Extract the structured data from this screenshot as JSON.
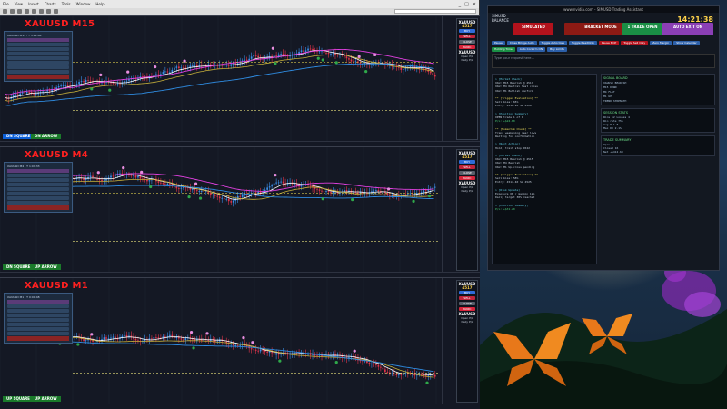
{
  "app": {
    "menu": [
      "File",
      "View",
      "Insert",
      "Charts",
      "Tools",
      "Window",
      "Help"
    ],
    "window_controls": [
      "_",
      "□",
      "✕"
    ]
  },
  "panes": [
    {
      "title": "XAUUSD M15",
      "panel_title": "XAUUSD M15 - T 5:14:06",
      "arrow_left": "DN SQUARE",
      "arrow_right": "DN ARROW",
      "right_sym": "XAUUSD",
      "right_price": "4517",
      "right_sub1": "Open P/L",
      "right_sub2": "Daily P/L",
      "btn1": "BUY",
      "btn2": "SELL",
      "btn3": "CLOSE",
      "btn4": "PANIC"
    },
    {
      "title": "XAUUSD M4",
      "panel_title": "XAUUSD M4 - T 1:07:33",
      "arrow_left": "DN SQUARE",
      "arrow_right": "UP ARROW",
      "right_sym": "XAUUSD",
      "right_price": "4517",
      "right_sub1": "Open P/L",
      "right_sub2": "Daily P/L",
      "btn1": "BUY",
      "btn2": "SELL",
      "btn3": "CLOSE",
      "btn4": "PANIC"
    },
    {
      "title": "XAUUSD M1",
      "panel_title": "XAUUSD M1 - T 0:00:48",
      "arrow_left": "UP SQUARE",
      "arrow_right": "UP ARROW",
      "right_sym": "XAUUSD",
      "right_price": "4517",
      "right_sub1": "Open P/L",
      "right_sub2": "Daily P/L",
      "btn1": "BUY",
      "btn2": "SELL",
      "btn3": "CLOSE",
      "btn4": "PANIC"
    }
  ],
  "ea": {
    "window_title": "www.nvidia.com - SIMUSD Trading Assistant",
    "clock": "14:21:38",
    "head1": "SIMUSD",
    "head2": "BALANCE",
    "big_buttons": [
      "SIMULATED",
      "BRACKET MODE",
      "1 TRADE OPEN",
      "AUTO EXIT ON"
    ],
    "small_buttons": [
      "Pause",
      "Close Bridge Auto",
      "Toggle Autoclose",
      "Toggle ReadOnly",
      "Pause MCP",
      "Toggle Sell Only",
      "Zero Margin",
      "Show Calendar",
      "Holding Time",
      "Auto Confirm ON",
      "Buy Limits"
    ],
    "input_placeholder": "Type your request here...",
    "log_lines": [
      "> [Market Check]",
      "XAU: M15 Bearish @ 4517",
      "XAU: M4 Neutral fast cross",
      "XAU: M1 Bullish confirm",
      "",
      "** [Trigger Evaluation] **",
      "  Sell bias: 65%",
      "  Entry: 4518.20 SL 4526",
      "",
      "> [Position Summary]",
      "  OPEN trade 1 of 1",
      "  P/L: +$24.80",
      "",
      "** [Momentum Check] **",
      "  Trend weakening near lows",
      "  Waiting for confirmation",
      "",
      "> [Next Action]",
      "  Hold, trail stop 4522",
      "",
      "> [Market Check]",
      "XAU: M15 Bearish @ 4515",
      "XAU: M4 Bearish",
      "XAU: M1 Up-cross pending",
      "",
      "** [Trigger Evaluation] **",
      "  Sell bias: 58%",
      "  Entry: 4517.40 SL 4525",
      "",
      "> [Risk Update]",
      "  Exposure OK / margin 12%",
      "  Daily target 38% reached",
      "",
      "> [Position Summary]",
      "  P/L: +$31.20"
    ],
    "market_header": "SIGNAL BOARD",
    "market_lines": [
      "XAUUSD BEARISH",
      "M15 DOWN",
      "M4 FLAT",
      "M1 UP",
      "TREND STRENGTH"
    ],
    "session_header": "SESSION STATS",
    "session_lines": [
      "Wins 12  Losses 4",
      "Win rate 75%",
      "Avg R 1.8",
      "Max DD 2.1%"
    ],
    "summary_header": "TRADE SUMMARY",
    "summary_lines": [
      "Open 1",
      "Closed 16",
      "Net +$412.60"
    ]
  }
}
